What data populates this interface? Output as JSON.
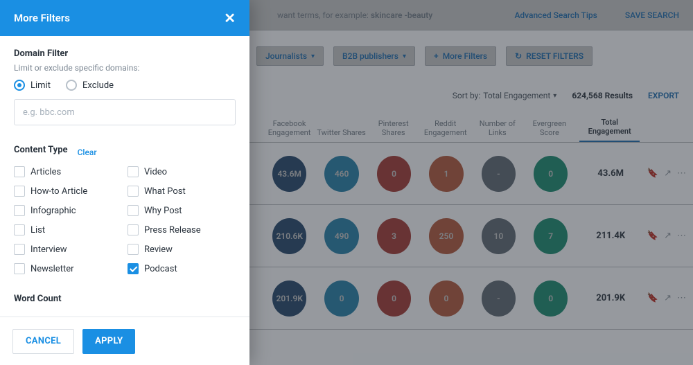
{
  "bg": {
    "search_hint_prefix": "want terms, for example: ",
    "search_hint_sample": "skincare -beauty",
    "tips": "Advanced Search Tips",
    "save": "SAVE SEARCH",
    "toolbar": {
      "journalists": "Journalists",
      "publishers": "B2B publishers",
      "more": "More Filters",
      "plus": "+",
      "reset": "RESET FILTERS",
      "reset_icon": "↻"
    },
    "resultsbar": {
      "sort_label": "Sort by:",
      "sort_value": "Total Engagement",
      "count": "624,568 Results",
      "export": "EXPORT"
    },
    "cols": {
      "fb": "Facebook Engagement",
      "tw": "Twitter Shares",
      "pn": "Pinterest Shares",
      "rd": "Reddit Engagement",
      "li": "Number of Links",
      "ev": "Evergreen Score",
      "tot": "Total Engagement"
    },
    "rows": [
      {
        "fb": "43.6M",
        "tw": "460",
        "pn": "0",
        "rd": "1",
        "li": "-",
        "ev": "0",
        "tot": "43.6M"
      },
      {
        "fb": "210.6K",
        "tw": "490",
        "pn": "3",
        "rd": "250",
        "li": "10",
        "ev": "7",
        "tot": "211.4K"
      },
      {
        "fb": "201.9K",
        "tw": "0",
        "pn": "0",
        "rd": "0",
        "li": "-",
        "ev": "0",
        "tot": "201.9K"
      }
    ]
  },
  "modal": {
    "title": "More Filters",
    "domain": {
      "heading": "Domain Filter",
      "sub": "Limit or exclude specific domains:",
      "limit": "Limit",
      "exclude": "Exclude",
      "placeholder": "e.g. bbc.com"
    },
    "content_type": {
      "heading": "Content Type",
      "clear": "Clear",
      "items": [
        {
          "label": "Articles",
          "checked": false
        },
        {
          "label": "Video",
          "checked": false
        },
        {
          "label": "How-to Article",
          "checked": false
        },
        {
          "label": "What Post",
          "checked": false
        },
        {
          "label": "Infographic",
          "checked": false
        },
        {
          "label": "Why Post",
          "checked": false
        },
        {
          "label": "List",
          "checked": false
        },
        {
          "label": "Press Release",
          "checked": false
        },
        {
          "label": "Interview",
          "checked": false
        },
        {
          "label": "Review",
          "checked": false
        },
        {
          "label": "Newsletter",
          "checked": false
        },
        {
          "label": "Podcast",
          "checked": true
        }
      ]
    },
    "word_count": {
      "heading": "Word Count"
    },
    "footer": {
      "cancel": "CANCEL",
      "apply": "APPLY"
    }
  }
}
